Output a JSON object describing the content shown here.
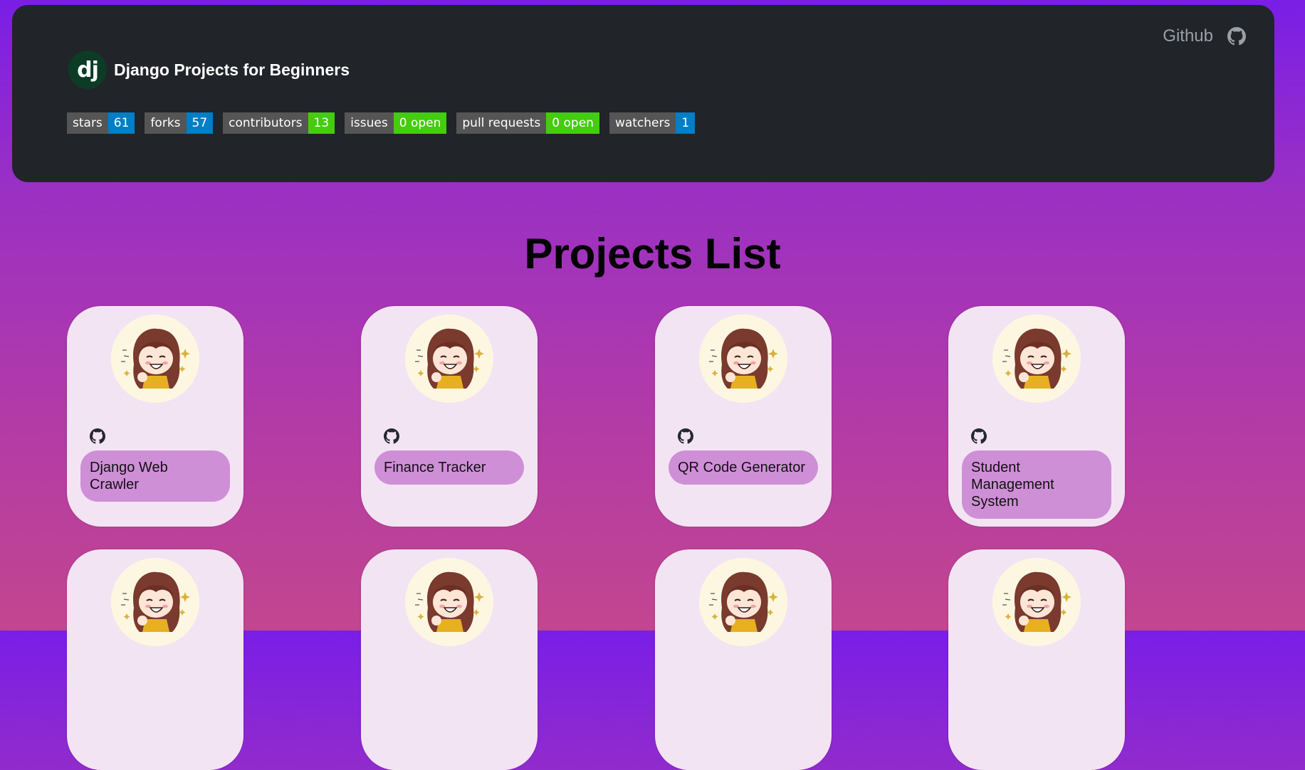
{
  "header": {
    "title": "Django Projects for Beginners",
    "logo_text": "dj",
    "github_label": "Github",
    "badges": [
      {
        "label": "stars",
        "value": "61",
        "color": "#007ec6"
      },
      {
        "label": "forks",
        "value": "57",
        "color": "#007ec6"
      },
      {
        "label": "contributors",
        "value": "13",
        "color": "#44cc11"
      },
      {
        "label": "issues",
        "value": "0 open",
        "color": "#44cc11"
      },
      {
        "label": "pull requests",
        "value": "0 open",
        "color": "#44cc11"
      },
      {
        "label": "watchers",
        "value": "1",
        "color": "#007ec6"
      }
    ]
  },
  "main": {
    "title": "Projects List",
    "projects": [
      {
        "name": "Django Web Crawler",
        "icon": "github-icon",
        "avatar": "anime-girl-thumbs-up"
      },
      {
        "name": "Finance Tracker",
        "icon": "github-icon",
        "avatar": "anime-girl-thumbs-up"
      },
      {
        "name": "QR Code Generator",
        "icon": "github-icon",
        "avatar": "anime-girl-thumbs-up"
      },
      {
        "name": "Student Management System",
        "icon": "github-icon",
        "avatar": "anime-girl-thumbs-up"
      },
      {
        "name": "",
        "icon": "github-icon",
        "avatar": "anime-girl-thumbs-up"
      },
      {
        "name": "",
        "icon": "github-icon",
        "avatar": "anime-girl-thumbs-up"
      },
      {
        "name": "",
        "icon": "github-icon",
        "avatar": "anime-girl-thumbs-up"
      },
      {
        "name": "",
        "icon": "github-icon",
        "avatar": "anime-girl-thumbs-up"
      }
    ]
  }
}
